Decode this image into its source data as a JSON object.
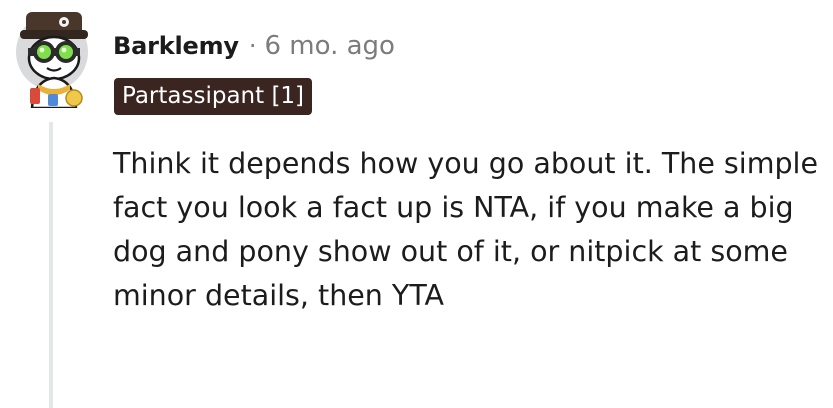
{
  "comment": {
    "username": "Barklemy",
    "separator": "·",
    "timestamp": "6 mo. ago",
    "flair": "Partassipant [1]",
    "body": "Think it depends how you go about it. The simple fact you look a fact up is NTA, if you make a big dog and pony show out of it, or nitpick at some minor details, then YTA"
  },
  "colors": {
    "flair_background": "#3b2520",
    "flair_text": "#ffffff",
    "username": "#1c1c1c",
    "meta": "#7c7c7c",
    "thread_line": "#e4e7ea"
  },
  "icons": {
    "avatar": "snoo-avatar-with-green-goggles"
  }
}
